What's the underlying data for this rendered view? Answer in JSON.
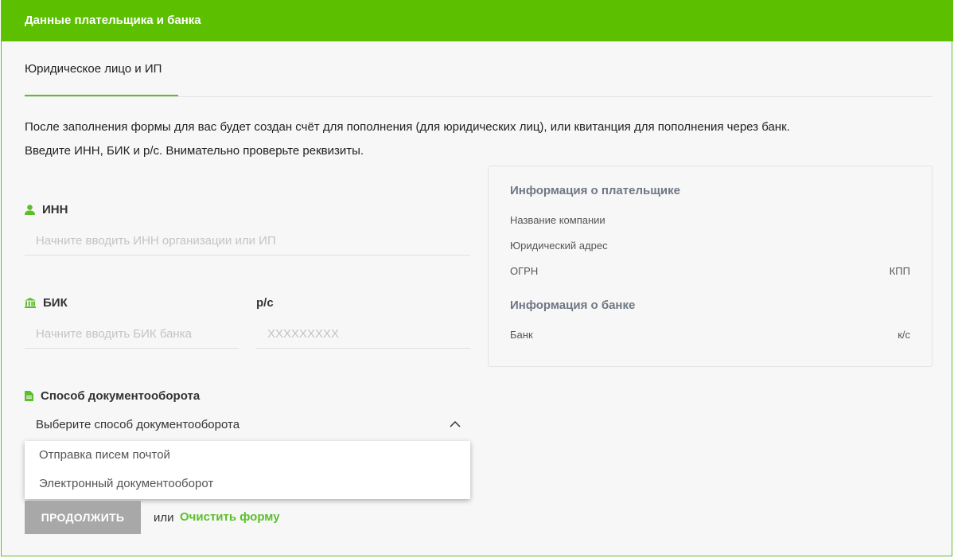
{
  "header": {
    "title": "Данные плательщика и банка"
  },
  "tabs": [
    {
      "label": "Юридическое лицо и ИП"
    }
  ],
  "description": {
    "line1": "После заполнения формы для вас будет создан счёт для пополнения (для юридических лиц), или квитанция для пополнения через банк.",
    "line2": "Введите ИНН, БИК и р/с. Внимательно проверьте реквизиты."
  },
  "inn": {
    "label": "ИНН",
    "placeholder": "Начните вводить ИНН организации или ИП",
    "value": ""
  },
  "bik": {
    "label": "БИК",
    "placeholder": "Начните вводить БИК банка",
    "value": ""
  },
  "account": {
    "label": "р/с",
    "placeholder": "XXXXXXXXX",
    "value": ""
  },
  "docflow": {
    "label": "Способ документооборота",
    "selected": "Выберите способ документооборота",
    "options": [
      "Отправка писем почтой",
      "Электронный документооборот"
    ]
  },
  "payer_info": {
    "title": "Информация о плательщике",
    "company": "Название компании",
    "address": "Юридический адрес",
    "ogrn": "ОГРН",
    "kpp": "КПП"
  },
  "bank_info": {
    "title": "Информация о банке",
    "bank": "Банк",
    "ks": "к/с"
  },
  "actions": {
    "continue": "ПРОДОЛЖИТЬ",
    "or": "или",
    "clear": "Очистить форму"
  },
  "colors": {
    "accent": "#5cbf00",
    "button_disabled": "#a8a8a8",
    "info_heading": "#6e7785"
  },
  "icons": {
    "inn": "user-icon",
    "bik": "bank-icon",
    "docflow": "document-icon",
    "select": "chevron-up-icon"
  }
}
